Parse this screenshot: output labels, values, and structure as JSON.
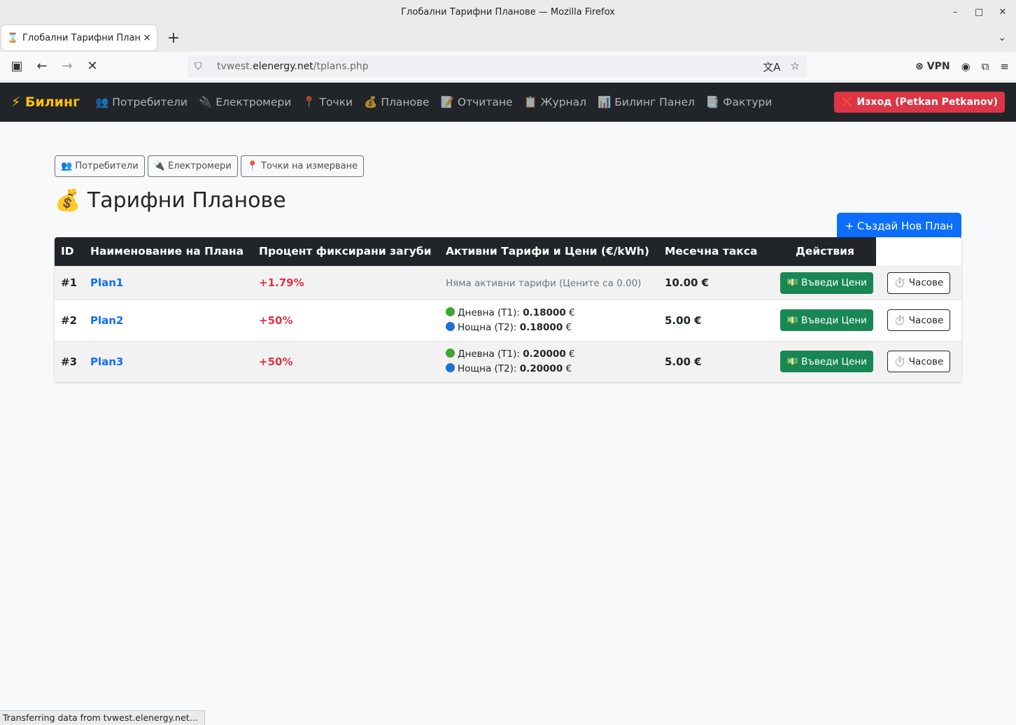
{
  "window": {
    "title": "Глобални Тарифни Планове — Mozilla Firefox",
    "controls": [
      "–",
      "□",
      "✕"
    ]
  },
  "tabs": [
    {
      "title": "Глобални Тарифни Планове",
      "icon": "hourglass-icon",
      "glyph": "⌛",
      "close": "×"
    }
  ],
  "tabbar": {
    "new_tab": "+",
    "list_tabs": "⌄"
  },
  "toolbar": {
    "sidebar": "▣",
    "back": "←",
    "forward": "→",
    "stop": "✕",
    "url_host": "tvwest.",
    "url_domain": "elenergy.net",
    "url_path": "/tplans.php",
    "translate": "文A",
    "bookmark": "☆",
    "vpn": "VPN",
    "account": "◉",
    "extensions": "⧉",
    "menu": "≡"
  },
  "app": {
    "brand": "⚡ Билинг",
    "nav": [
      {
        "label": "👥 Потребители"
      },
      {
        "label": "🔌 Електромери"
      },
      {
        "label": "📍 Точки"
      },
      {
        "label": "💰 Планове"
      },
      {
        "label": "📝 Отчитане"
      },
      {
        "label": "📋 Журнал"
      },
      {
        "label": "📊 Билинг Панел"
      },
      {
        "label": "📑 Фактури"
      }
    ],
    "logout": "❌ Изход (Petkan Petkanov)"
  },
  "quicklinks": [
    "👥 Потребители",
    "🔌 Електромери",
    "📍 Точки на измерване"
  ],
  "page": {
    "title": "💰 Тарифни Планове",
    "create_button": "+ Създай Нов План"
  },
  "table": {
    "headers": [
      "ID",
      "Наименование на Плана",
      "Процент фиксирани загуби",
      "Активни Тарифи и Цени (€/kWh)",
      "Месечна такса",
      "Действия"
    ],
    "rows": [
      {
        "id": "#1",
        "name": "Plan1",
        "loss": "+1.79%",
        "no_tariffs": "Няма активни тарифи (Цените са 0.00)",
        "fee": "10.00 €",
        "prices_btn": "💵 Въведи Цени",
        "hours_btn": "⏱️ Часове"
      },
      {
        "id": "#2",
        "name": "Plan2",
        "loss": "+50%",
        "day_label": "Дневна (T1): ",
        "day_value": "0.18000",
        "night_label": "Нощна (T2): ",
        "night_value": "0.18000",
        "currency": " €",
        "fee": "5.00 €",
        "prices_btn": "💵 Въведи Цени",
        "hours_btn": "⏱️ Часове"
      },
      {
        "id": "#3",
        "name": "Plan3",
        "loss": "+50%",
        "day_label": "Дневна (T1): ",
        "day_value": "0.20000",
        "night_label": "Нощна (T2): ",
        "night_value": "0.20000",
        "currency": " €",
        "fee": "5.00 €",
        "prices_btn": "💵 Въведи Цени",
        "hours_btn": "⏱️ Часове"
      }
    ]
  },
  "status": "Transferring data from tvwest.elenergy.net…",
  "colors": {
    "navbar": "#212529",
    "brand": "#ffc107",
    "primary": "#0d6efd",
    "success": "#198754",
    "danger": "#dc3545"
  }
}
